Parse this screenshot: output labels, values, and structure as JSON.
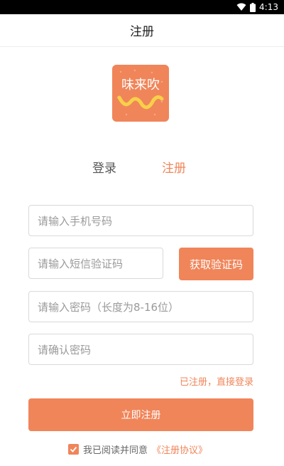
{
  "status_bar": {
    "time": "4:13",
    "wifi_icon": "wifi-icon",
    "battery_icon": "battery-icon"
  },
  "header": {
    "title": "注册"
  },
  "logo": {
    "text": "味来吹"
  },
  "tabs": {
    "login": "登录",
    "register": "注册",
    "active": "register"
  },
  "form": {
    "phone_placeholder": "请输入手机号码",
    "sms_code_placeholder": "请输入短信验证码",
    "get_code_button": "获取验证码",
    "password_placeholder": "请输入密码（长度为8-16位）",
    "confirm_password_placeholder": "请确认密码",
    "login_link": "已注册，直接登录",
    "submit_button": "立即注册",
    "agreement_checked": true,
    "agreement_text": "我已阅读并同意",
    "agreement_link": "《注册协议》"
  },
  "colors": {
    "accent": "#f0855a",
    "border": "#d9d9d9",
    "placeholder": "#9a9a9a"
  }
}
